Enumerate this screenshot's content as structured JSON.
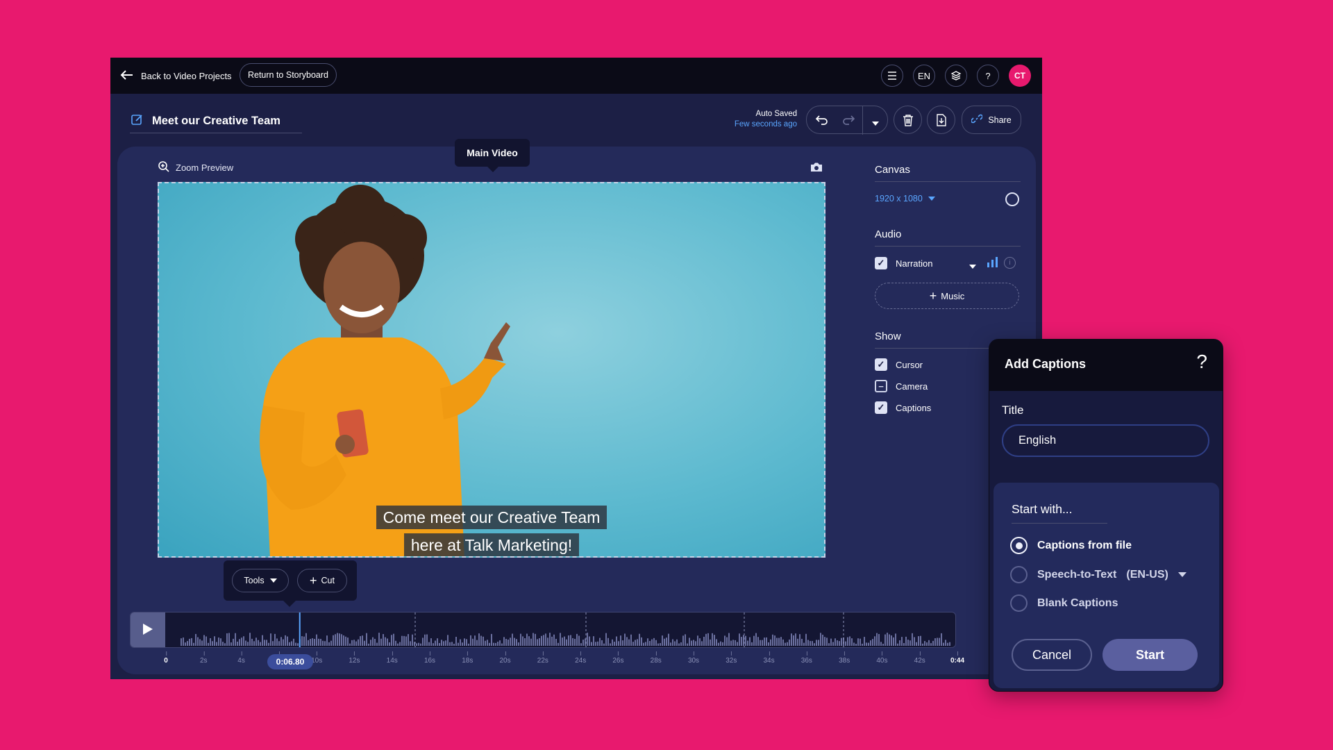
{
  "topbar": {
    "back_label": "Back to Video Projects",
    "storyboard_label": "Return to Storyboard",
    "lang_label": "EN",
    "help_label": "?",
    "avatar_initials": "CT"
  },
  "project": {
    "title": "Meet our Creative Team",
    "saved_status": "Auto Saved",
    "saved_time": "Few seconds ago",
    "share_label": "Share"
  },
  "preview": {
    "zoom_label": "Zoom Preview",
    "tooltip": "Main Video",
    "caption_line1": "Come meet our Creative Team",
    "caption_line2": "here at Talk Marketing!"
  },
  "side": {
    "canvas_heading": "Canvas",
    "canvas_size": "1920 x 1080",
    "audio_heading": "Audio",
    "narration_label": "Narration",
    "music_label": "Music",
    "show_heading": "Show",
    "cursor_label": "Cursor",
    "camera_label": "Camera",
    "captions_label": "Captions"
  },
  "tools": {
    "tools_label": "Tools",
    "cut_label": "Cut"
  },
  "timeline": {
    "playhead_time": "0:06.80",
    "playhead_fraction": 0.155,
    "ticks": [
      "0",
      "2s",
      "4s",
      "",
      "10s",
      "12s",
      "14s",
      "16s",
      "18s",
      "20s",
      "22s",
      "24s",
      "26s",
      "28s",
      "30s",
      "32s",
      "34s",
      "36s",
      "38s",
      "40s",
      "42s",
      "0:44"
    ]
  },
  "dialog": {
    "title": "Add Captions",
    "help": "?",
    "title_label": "Title",
    "title_value": "English",
    "start_with": "Start with...",
    "option1": "Captions from file",
    "option2": "Speech-to-Text",
    "option2_lang": "(EN-US)",
    "option3": "Blank Captions",
    "cancel_label": "Cancel",
    "start_label": "Start"
  },
  "colors": {
    "background": "#e8196e",
    "app_bg": "#1c1f45",
    "accent": "#5aa6ff",
    "avatar": "#e8196e"
  }
}
